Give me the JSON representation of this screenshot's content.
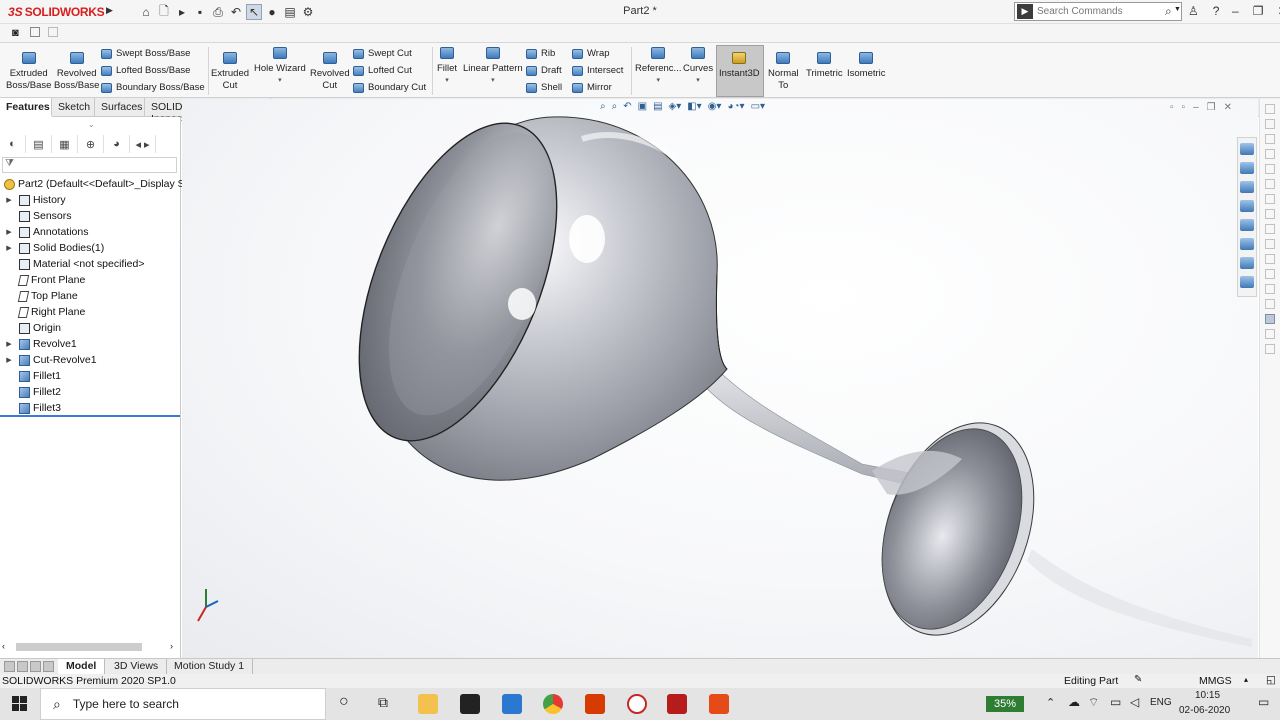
{
  "app": {
    "logo_ds": "3S",
    "logo_name": "SOLIDWORKS",
    "document_title": "Part2 *",
    "search_placeholder": "Search Commands"
  },
  "command_manager": {
    "extruded_boss": [
      "Extruded",
      "Boss/Base"
    ],
    "revolved_boss": [
      "Revolved",
      "Boss/Base"
    ],
    "swept_boss": "Swept Boss/Base",
    "lofted_boss": "Lofted Boss/Base",
    "boundary_boss": "Boundary Boss/Base",
    "extruded_cut": [
      "Extruded",
      "Cut"
    ],
    "hole_wizard": "Hole Wizard",
    "revolved_cut": [
      "Revolved",
      "Cut"
    ],
    "swept_cut": "Swept Cut",
    "lofted_cut": "Lofted Cut",
    "boundary_cut": "Boundary Cut",
    "fillet": "Fillet",
    "linear_pattern": "Linear Pattern",
    "rib": "Rib",
    "draft": "Draft",
    "shell": "Shell",
    "wrap": "Wrap",
    "intersect": "Intersect",
    "mirror": "Mirror",
    "reference": "Referenc...",
    "curves": "Curves",
    "instant3d": "Instant3D",
    "normal_to": [
      "Normal",
      "To"
    ],
    "trimetric": "Trimetric",
    "isometric": "Isometric"
  },
  "command_tabs": [
    "Features",
    "Sketch",
    "Surfaces",
    "SOLIDWORKS Inspection"
  ],
  "feature_tree": {
    "root": "Part2  (Default<<Default>_Display S",
    "items": [
      {
        "label": "History",
        "expandable": true,
        "icon": "history-folder-icon"
      },
      {
        "label": "Sensors",
        "expandable": false,
        "icon": "sensors-icon"
      },
      {
        "label": "Annotations",
        "expandable": true,
        "icon": "annotations-icon"
      },
      {
        "label": "Solid Bodies(1)",
        "expandable": true,
        "icon": "solid-bodies-icon"
      },
      {
        "label": "Material <not specified>",
        "expandable": false,
        "icon": "material-icon"
      },
      {
        "label": "Front Plane",
        "expandable": false,
        "icon": "plane-icon"
      },
      {
        "label": "Top Plane",
        "expandable": false,
        "icon": "plane-icon"
      },
      {
        "label": "Right Plane",
        "expandable": false,
        "icon": "plane-icon"
      },
      {
        "label": "Origin",
        "expandable": false,
        "icon": "origin-icon"
      },
      {
        "label": "Revolve1",
        "expandable": true,
        "icon": "revolve-feature-icon"
      },
      {
        "label": "Cut-Revolve1",
        "expandable": true,
        "icon": "cut-revolve-feature-icon"
      },
      {
        "label": "Fillet1",
        "expandable": false,
        "icon": "fillet-feature-icon"
      },
      {
        "label": "Fillet2",
        "expandable": false,
        "icon": "fillet-feature-icon"
      },
      {
        "label": "Fillet3",
        "expandable": false,
        "icon": "fillet-feature-icon"
      }
    ]
  },
  "bottom_tabs": [
    "Model",
    "3D Views",
    "Motion Study 1"
  ],
  "status": {
    "product": "SOLIDWORKS Premium 2020 SP1.0",
    "mode": "Editing Part",
    "units": "MMGS"
  },
  "taskbar": {
    "search_placeholder": "Type here to search",
    "battery": "35%",
    "language": "ENG",
    "time": "10:15",
    "date": "02-06-2020"
  },
  "colors": {
    "accent_blue": "#3b7bd4",
    "brand_red": "#d81e1e",
    "instant3d_active": "#c8c8c8"
  }
}
